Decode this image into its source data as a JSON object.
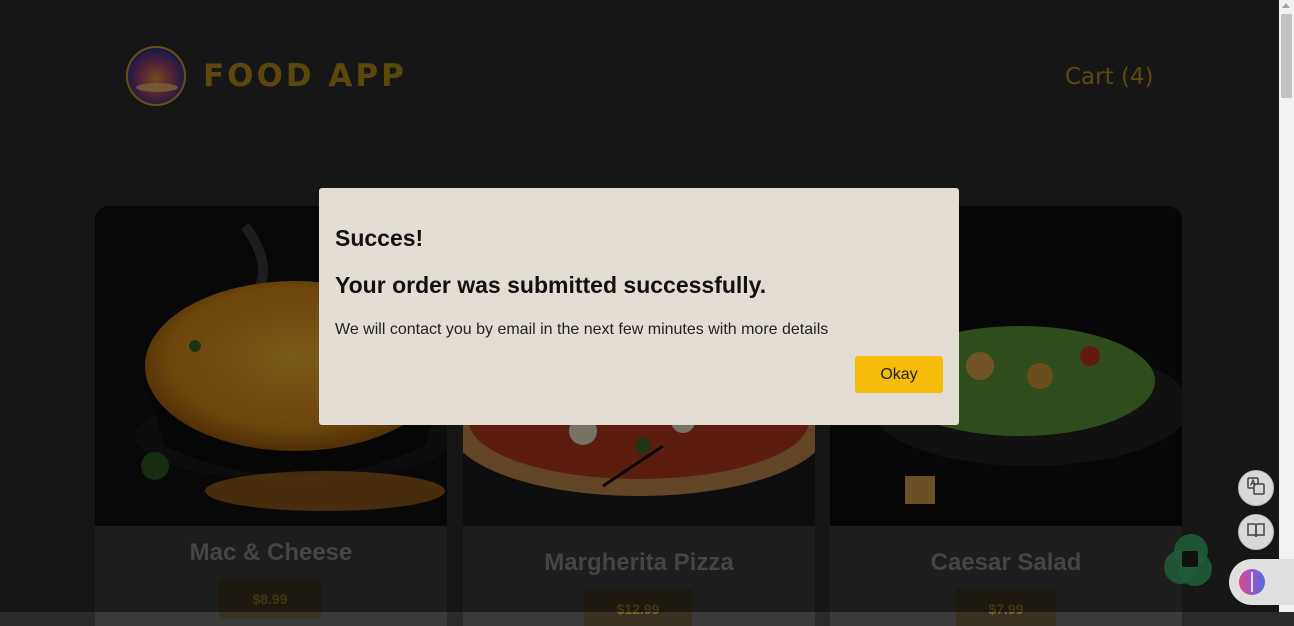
{
  "header": {
    "brand": "FOOD APP",
    "cart_label": "Cart (4)"
  },
  "menu": {
    "items": [
      {
        "name": "Mac & Cheese",
        "price": "$8.99"
      },
      {
        "name": "Margherita Pizza",
        "price": "$12.99"
      },
      {
        "name": "Caesar Salad",
        "price": "$7.99"
      }
    ]
  },
  "modal": {
    "title": "Succes!",
    "subtitle": "Your order was submitted successfully.",
    "message": "We will contact you by email in the next few minutes with more details",
    "button_label": "Okay"
  },
  "colors": {
    "brand": "#b8901a",
    "accent_button": "#f5bd0a",
    "modal_background": "#e4ddd3"
  },
  "icons": {
    "translate": "translate-icon",
    "reader": "reader-mode-icon",
    "brain": "brain-icon"
  }
}
